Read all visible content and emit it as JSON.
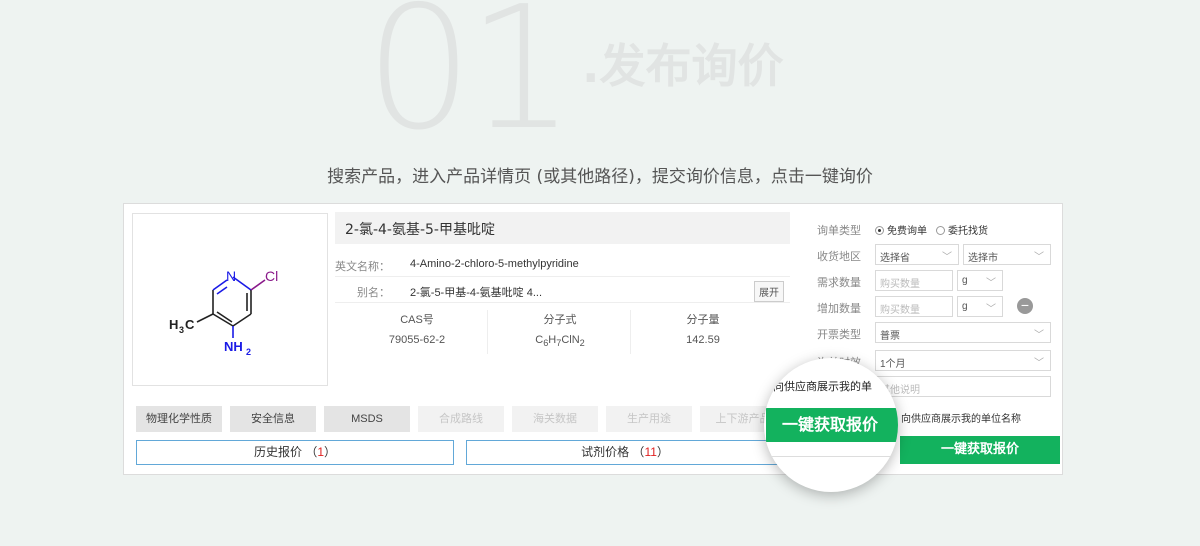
{
  "header": {
    "step_number": "01",
    "step_title": ".发布询价",
    "subtitle": "搜索产品，进入产品详情页 (或其他路径)，提交询价信息，点击一键询价"
  },
  "product": {
    "name": "2-氯-4-氨基-5-甲基吡啶",
    "english_label": "英文名称：",
    "english_value": "4-Amino-2-chloro-5-methylpyridine",
    "alias_label": "别名：",
    "alias_value": "2-氯-5-甲基-4-氨基吡啶 4...",
    "expand": "展开",
    "structure": {
      "atom_n": "N",
      "atom_cl": "Cl",
      "h3c": "H",
      "h3c_sub": "3",
      "h3c_c": "C",
      "nh": "NH",
      "nh_sub": "2"
    },
    "props": [
      {
        "label": "CAS号",
        "value": "79055-62-2"
      },
      {
        "label": "分子式",
        "value": "C6H7ClN2"
      },
      {
        "label": "分子量",
        "value": "142.59"
      }
    ],
    "formula_parts": {
      "c": "C",
      "c_n": "6",
      "h": "H",
      "h_n": "7",
      "rest": "ClN",
      "n_n": "2"
    }
  },
  "tabs": [
    {
      "label": "物理化学性质",
      "enabled": true
    },
    {
      "label": "安全信息",
      "enabled": true
    },
    {
      "label": "MSDS",
      "enabled": true
    },
    {
      "label": "合成路线",
      "enabled": false
    },
    {
      "label": "海关数据",
      "enabled": false
    },
    {
      "label": "生产用途",
      "enabled": false
    },
    {
      "label": "上下游产品",
      "enabled": false
    }
  ],
  "price_buttons": [
    {
      "label": "历史报价",
      "count": "1"
    },
    {
      "label": "试剂价格",
      "count": "11"
    }
  ],
  "form": {
    "inquiry_type_label": "询单类型",
    "inquiry_type_options": [
      "免费询单",
      "委托找货"
    ],
    "region_label": "收货地区",
    "province_placeholder": "选择省",
    "city_placeholder": "选择市",
    "qty_label": "需求数量",
    "qty_placeholder": "购买数量",
    "unit": "g",
    "add_qty_label": "增加数量",
    "add_qty_placeholder": "购买数量",
    "add_unit": "g",
    "invoice_label": "开票类型",
    "invoice_value": "普票",
    "validity_label": "询单时效",
    "validity_value": "1个月",
    "note_placeholder": "其他说明",
    "show_name_text": "向供应商展示我的单位名称",
    "submit_label": "一键获取报价"
  },
  "magnifier": {
    "text": "向供应商展示我的单",
    "button_label": "一键获取报价"
  }
}
